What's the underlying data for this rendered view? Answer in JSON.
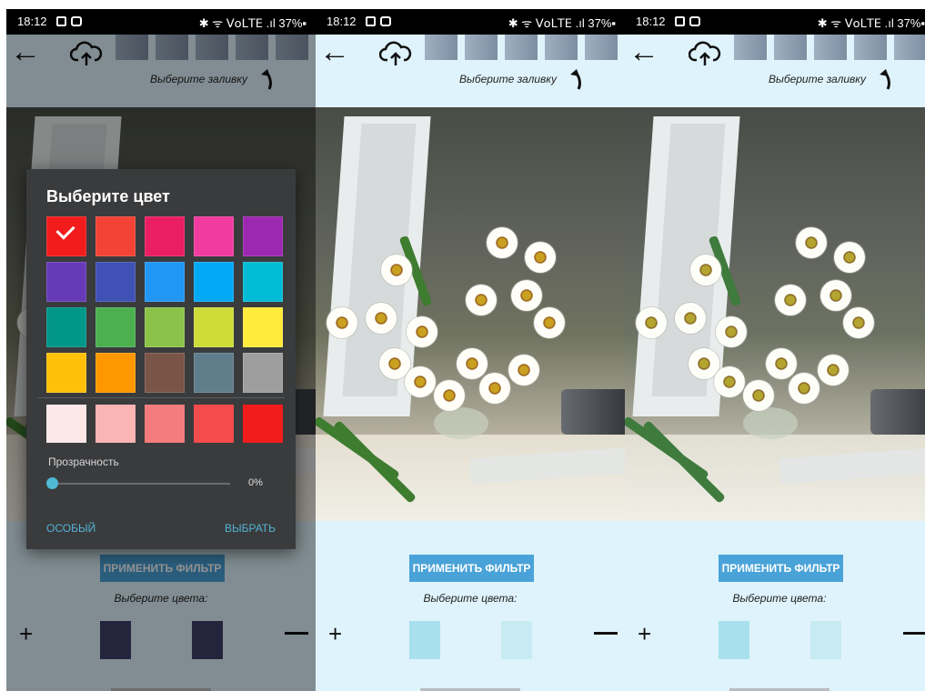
{
  "status": {
    "time": "18:12",
    "right": "✱ ᯤ 𝖵𝗈𝖫𝖳𝖤 .ıl 37%▪"
  },
  "toolbar": {
    "fill_hint": "Выберите заливку"
  },
  "actions": {
    "apply_filter": "ПРИМЕНИТЬ ФИЛЬТР",
    "choose_colors": "Выберите цвета:",
    "plus": "+"
  },
  "dialog": {
    "title": "Выберите цвет",
    "palette": [
      "#f21c1c",
      "#f44336",
      "#e91e63",
      "#f23b9e",
      "#9c27b0",
      "#673ab7",
      "#3f51b5",
      "#2196f3",
      "#03a9f4",
      "#00bcd4",
      "#009688",
      "#4caf50",
      "#8bc34a",
      "#cddc39",
      "#ffeb3b",
      "#ffc107",
      "#ff9800",
      "#795548",
      "#607d8b",
      "#9e9e9e"
    ],
    "selected_index": 0,
    "shades": [
      "#fde8e8",
      "#f9b4b4",
      "#f57c7c",
      "#f44c4c",
      "#f21c1c"
    ],
    "opacity_label": "Прозрачность",
    "opacity_value": "0%",
    "opacity_fraction": 0.0,
    "custom_button": "ОСОБЫЙ",
    "select_button": "ВЫБРАТЬ"
  },
  "panels": [
    {
      "swatches": [
        "#3e4169",
        "#3e4169"
      ]
    },
    {
      "swatches": [
        "#a8e0ee",
        "#c7eaf3"
      ]
    },
    {
      "swatches": [
        "#a8e0ee",
        "#c7eaf3"
      ]
    }
  ],
  "colors": {
    "accent": "#4aa3d8",
    "panel_bg": "#dff3fc",
    "dialog_bg": "#3a3b3d"
  }
}
